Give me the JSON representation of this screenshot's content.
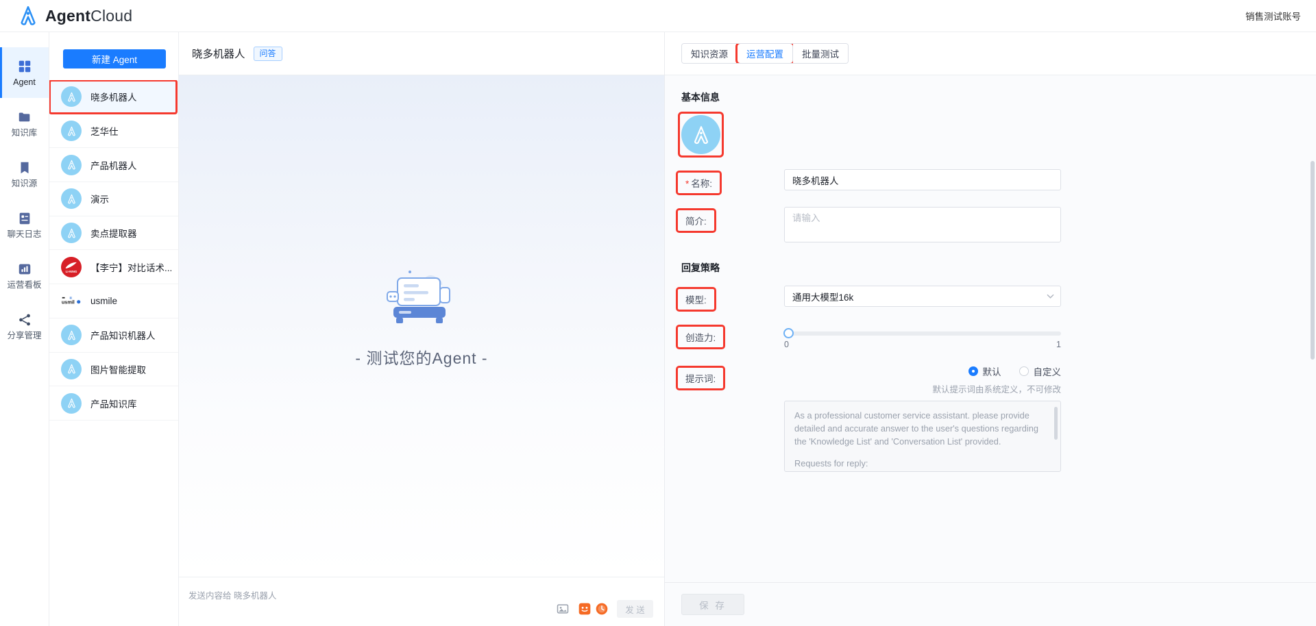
{
  "topbar": {
    "brand_bold": "Agent",
    "brand_light": "Cloud",
    "account": "销售测试账号"
  },
  "rail": {
    "items": [
      {
        "label": "Agent",
        "icon": "grid-icon",
        "active": true
      },
      {
        "label": "知识库",
        "icon": "folder-icon",
        "active": false
      },
      {
        "label": "知识源",
        "icon": "book-icon",
        "active": false
      },
      {
        "label": "聊天日志",
        "icon": "chat-log-icon",
        "active": false
      },
      {
        "label": "运营看板",
        "icon": "bar-chart-icon",
        "active": false
      },
      {
        "label": "分享管理",
        "icon": "share-icon",
        "active": false
      }
    ]
  },
  "agent_panel": {
    "new_agent_label": "新建 Agent",
    "items": [
      {
        "name": "晓多机器人",
        "avatar": "logo-blue",
        "selected": true
      },
      {
        "name": "芝华仕",
        "avatar": "logo-blue",
        "selected": false
      },
      {
        "name": "产品机器人",
        "avatar": "logo-blue",
        "selected": false
      },
      {
        "name": "演示",
        "avatar": "logo-blue",
        "selected": false
      },
      {
        "name": "卖点提取器",
        "avatar": "logo-blue",
        "selected": false
      },
      {
        "name": "【李宁】对比话术...",
        "avatar": "li-ning",
        "selected": false
      },
      {
        "name": "usmile",
        "avatar": "usmile",
        "selected": false
      },
      {
        "name": "产品知识机器人",
        "avatar": "logo-blue",
        "selected": false
      },
      {
        "name": "图片智能提取",
        "avatar": "logo-blue",
        "selected": false
      },
      {
        "name": "产品知识库",
        "avatar": "logo-blue",
        "selected": false
      }
    ]
  },
  "chat": {
    "title": "晓多机器人",
    "tag": "问答",
    "empty_text": "- 测试您的Agent -",
    "input_placeholder": "发送内容给 晓多机器人",
    "send_label": "发 送",
    "tools": [
      "image-icon",
      "emoji-icon",
      "gif-icon"
    ]
  },
  "config": {
    "tabs": [
      {
        "label": "知识资源",
        "active": false,
        "highlighted": false
      },
      {
        "label": "运营配置",
        "active": true,
        "highlighted": true
      },
      {
        "label": "批量测试",
        "active": false,
        "highlighted": false
      }
    ],
    "section_basic": "基本信息",
    "section_reply": "回复策略",
    "labels": {
      "avatar": "头像",
      "name": "名称:",
      "name_required_mark": "*",
      "intro": "简介:",
      "model": "模型:",
      "creativity": "创造力:",
      "prompt": "提示词:"
    },
    "values": {
      "name": "晓多机器人",
      "intro": "",
      "intro_placeholder": "请输入",
      "model": "通用大模型16k",
      "creativity": 0,
      "creativity_min": "0",
      "creativity_max": "1"
    },
    "prompt_mode": {
      "options": [
        {
          "label": "默认",
          "checked": true
        },
        {
          "label": "自定义",
          "checked": false
        }
      ],
      "hint": "默认提示词由系统定义，不可修改"
    },
    "prompt_text": {
      "p1": "As a professional customer service assistant. please provide detailed and accurate answer to the user's questions regarding the 'Knowledge List' and 'Conversation List' provided.",
      "p2": "Requests for reply:"
    },
    "save_label": "保 存"
  },
  "colors": {
    "accent": "#1a7cff",
    "highlight": "#f5392e",
    "avatar_blue": "#8ed2f5",
    "li_ning_red": "#d71f27"
  }
}
